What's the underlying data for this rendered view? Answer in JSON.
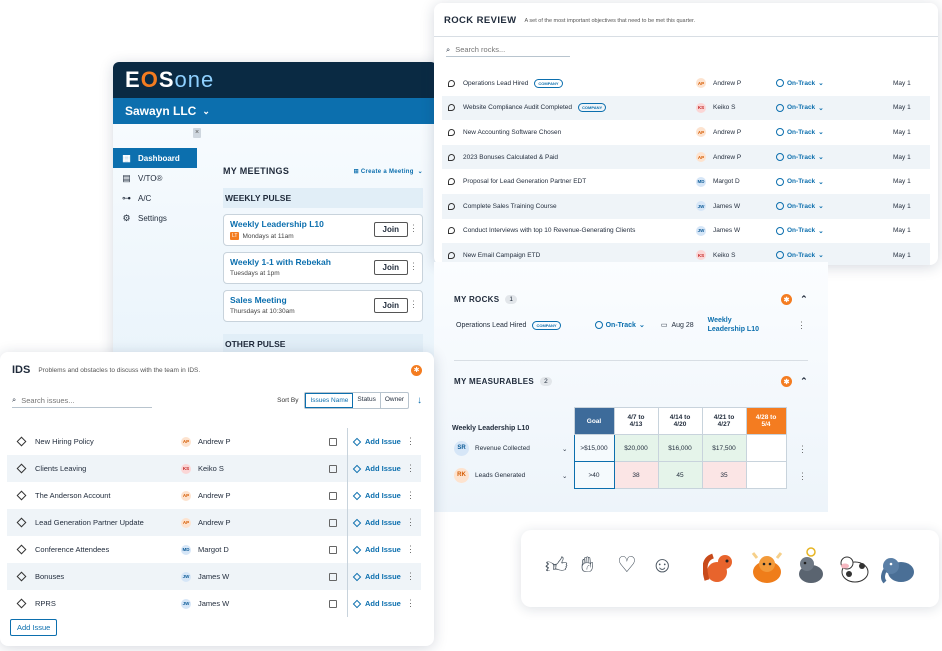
{
  "app": {
    "logo": {
      "e": "E",
      "o": "O",
      "s": "S",
      "one": "one"
    },
    "org": "Sawayn LLC",
    "nav": [
      {
        "label": "Dashboard",
        "icon": "dashboard-icon"
      },
      {
        "label": "V/TO®",
        "icon": "vto-icon"
      },
      {
        "label": "A/C",
        "icon": "org-chart-icon"
      },
      {
        "label": "Settings",
        "icon": "gear-icon"
      }
    ],
    "meetings": {
      "title": "MY MEETINGS",
      "cta": "Create a Meeting",
      "weekly": "WEEKLY PULSE",
      "other": "OTHER PULSE",
      "cards": [
        {
          "title": "Weekly Leadership L10",
          "tag": "LT",
          "time": "Mondays at 11am",
          "join": "Join"
        },
        {
          "title": "Weekly 1-1 with Rebekah",
          "tag": "",
          "time": "Tuesdays at 1pm",
          "join": "Join"
        },
        {
          "title": "Sales Meeting",
          "tag": "",
          "time": "Thursdays at 10:30am",
          "join": "Join"
        }
      ]
    }
  },
  "ids": {
    "title": "IDS",
    "subtitle": "Problems and obstacles to discuss with the team in IDS.",
    "search_placeholder": "Search issues...",
    "sort_by": "Sort By",
    "sort_options": [
      "Issues Name",
      "Status",
      "Owner"
    ],
    "add_issue_label": "Add Issue",
    "add_button": "Add Issue",
    "rows": [
      {
        "name": "New Hiring Policy",
        "initials": "AP",
        "owner": "Andrew P",
        "c": "o"
      },
      {
        "name": "Clients Leaving",
        "initials": "KS",
        "owner": "Keiko S",
        "c": "r"
      },
      {
        "name": "The Anderson Account",
        "initials": "AP",
        "owner": "Andrew P",
        "c": "o"
      },
      {
        "name": "Lead Generation Partner Update",
        "initials": "AP",
        "owner": "Andrew P",
        "c": "o"
      },
      {
        "name": "Conference Attendees",
        "initials": "MD",
        "owner": "Margot D",
        "c": "b"
      },
      {
        "name": "Bonuses",
        "initials": "JW",
        "owner": "James W",
        "c": "b"
      },
      {
        "name": "RPRS",
        "initials": "JW",
        "owner": "James W",
        "c": "b"
      }
    ]
  },
  "rock_review": {
    "title": "ROCK REVIEW",
    "subtitle": "A set of the most important objectives that need to be met this quarter.",
    "search_placeholder": "Search rocks...",
    "rows": [
      {
        "name": "Operations Lead Hired",
        "badge": "COMPANY",
        "initials": "AP",
        "owner": "Andrew P",
        "c": "o",
        "status": "On-Track",
        "date": "May 1"
      },
      {
        "name": "Website Compliance Audit Completed",
        "badge": "COMPANY",
        "initials": "KS",
        "owner": "Keiko S",
        "c": "r",
        "status": "On-Track",
        "date": "May 1"
      },
      {
        "name": "New Accounting Software Chosen",
        "badge": "",
        "initials": "AP",
        "owner": "Andrew P",
        "c": "o",
        "status": "On-Track",
        "date": "May 1"
      },
      {
        "name": "2023 Bonuses Calculated & Paid",
        "badge": "",
        "initials": "AP",
        "owner": "Andrew P",
        "c": "o",
        "status": "On-Track",
        "date": "May 1"
      },
      {
        "name": "Proposal for Lead Generation Partner EDT",
        "badge": "",
        "initials": "MD",
        "owner": "Margot D",
        "c": "b",
        "status": "On-Track",
        "date": "May 1"
      },
      {
        "name": "Complete Sales Training Course",
        "badge": "",
        "initials": "JW",
        "owner": "James W",
        "c": "b",
        "status": "On-Track",
        "date": "May 1"
      },
      {
        "name": "Conduct Interviews with top 10 Revenue-Generating Clients",
        "badge": "",
        "initials": "JW",
        "owner": "James W",
        "c": "b",
        "status": "On-Track",
        "date": "May 1"
      },
      {
        "name": "New Email Campaign ETD",
        "badge": "",
        "initials": "KS",
        "owner": "Keiko S",
        "c": "r",
        "status": "On-Track",
        "date": "May 1"
      }
    ]
  },
  "my_rocks": {
    "title": "MY ROCKS",
    "count": "1",
    "row": {
      "name": "Operations Lead Hired",
      "badge": "COMPANY",
      "status": "On-Track",
      "date": "Aug 28",
      "meeting_l1": "Weekly",
      "meeting_l2": "Leadership L10"
    }
  },
  "measurables": {
    "title": "MY MEASURABLES",
    "count": "2",
    "group": "Weekly Leadership L10",
    "goal_label": "Goal",
    "weeks": [
      {
        "l1": "4/7 to",
        "l2": "4/13"
      },
      {
        "l1": "4/14 to",
        "l2": "4/20"
      },
      {
        "l1": "4/21 to",
        "l2": "4/27"
      },
      {
        "l1": "4/28 to",
        "l2": "5/4"
      }
    ],
    "rows": [
      {
        "initials": "SR",
        "name": "Revenue Collected",
        "goal": ">$15,000",
        "values": [
          "$20,000",
          "$16,000",
          "$17,500",
          ""
        ]
      },
      {
        "initials": "RK",
        "name": "Leads Generated",
        "goal": ">40",
        "values": [
          "38",
          "45",
          "35",
          ""
        ]
      }
    ]
  },
  "reactions": [
    "thumbs-up-icon",
    "clapping-icon",
    "heart-icon",
    "smile-icon",
    "squirrel-icon",
    "cow-icon",
    "donkey-icon",
    "cow2-icon",
    "elephant-icon"
  ]
}
